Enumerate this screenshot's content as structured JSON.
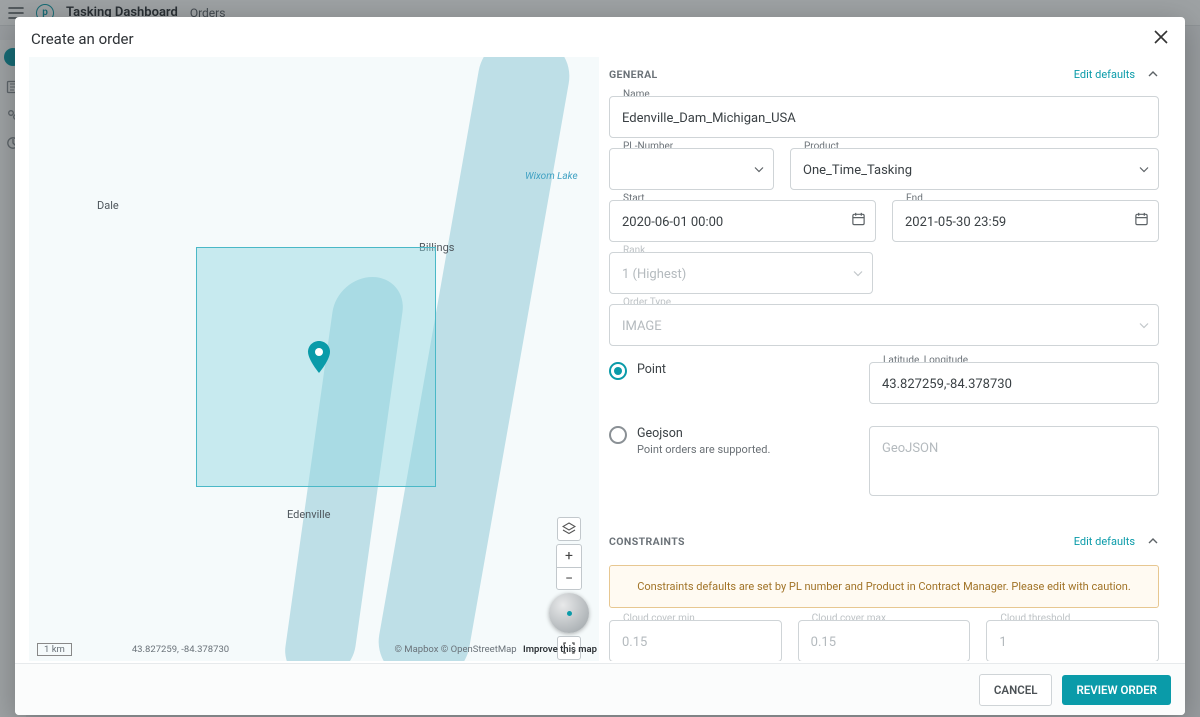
{
  "header": {
    "app_title": "Tasking Dashboard",
    "nav_link": "Orders",
    "monogram": "p"
  },
  "modal": {
    "title": "Create an order"
  },
  "map": {
    "lake_label": "Wixom Lake",
    "label_dale": "Dale",
    "label_billings": "Billings",
    "label_edenville": "Edenville",
    "scale_text": "1 km",
    "coord_text": "43.827259, -84.378730",
    "attribution": "© Mapbox © OpenStreetMap",
    "improve_text": "Improve this map"
  },
  "general": {
    "section_title": "GENERAL",
    "edit_link": "Edit defaults",
    "name_label": "Name",
    "name_value": "Edenville_Dam_Michigan_USA",
    "plnumber_label": "PL-Number",
    "plnumber_value": "",
    "product_label": "Product",
    "product_value": "One_Time_Tasking",
    "start_label": "Start",
    "start_value": "2020-06-01 00:00",
    "end_label": "End",
    "end_value": "2021-05-30 23:59",
    "rank_label": "Rank",
    "rank_value": "1 (Highest)",
    "ordertype_label": "Order Type",
    "ordertype_value": "IMAGE",
    "point_label": "Point",
    "latlon_label": "Latitude, Longitude",
    "latlon_value": "43.827259,-84.378730",
    "geojson_label": "Geojson",
    "geojson_note": "Point orders are supported.",
    "geojson_placeholder": "GeoJSON"
  },
  "constraints": {
    "section_title": "CONSTRAINTS",
    "edit_link": "Edit defaults",
    "warning": "Constraints defaults are set by PL number and Product in Contract Manager. Please edit with caution.",
    "ccmin_label": "Cloud cover min",
    "ccmin_value": "0.15",
    "ccmax_label": "Cloud cover max",
    "ccmax_value": "0.15",
    "cthresh_label": "Cloud threshold",
    "cthresh_value": "1"
  },
  "footer": {
    "cancel": "CANCEL",
    "review": "REVIEW ORDER"
  }
}
